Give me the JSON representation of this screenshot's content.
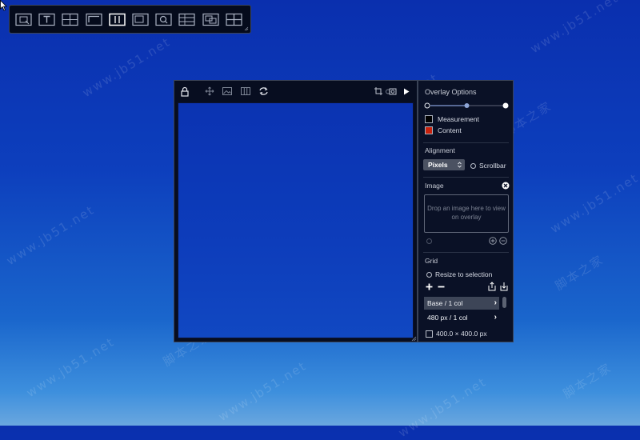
{
  "watermarks": [
    "www.jb51.net",
    "脚本之家"
  ],
  "palette": {
    "tools": [
      {
        "name": "screenshot-tool-icon"
      },
      {
        "name": "text-tool-icon"
      },
      {
        "name": "crosshair-tool-icon"
      },
      {
        "name": "corner-tool-icon"
      },
      {
        "name": "columns-tool-icon",
        "active": true
      },
      {
        "name": "frame-tool-icon"
      },
      {
        "name": "magnifier-tool-icon"
      },
      {
        "name": "gridlines-tool-icon"
      },
      {
        "name": "overlap-tool-icon"
      },
      {
        "name": "guides-tool-icon"
      }
    ]
  },
  "panel": {
    "title": "Overlay Options",
    "opacity_level": 0.5,
    "measurement_label": "Measurement",
    "content_label": "Content",
    "colors": {
      "measurement": "#000000",
      "content": "#c8210d"
    },
    "alignment_title": "Alignment",
    "alignment_value": "Pixels",
    "scrollbar_label": "Scrollbar",
    "image_title": "Image",
    "dropzone_text": "Drop an image here to view on overlay",
    "grid_title": "Grid",
    "resize_label": "Resize to selection",
    "grid_rows": [
      {
        "label": "Base / 1 col",
        "selected": true
      },
      {
        "label": "480 px / 1 col",
        "selected": false
      }
    ],
    "size_readout": "400.0 × 400.0 px"
  }
}
